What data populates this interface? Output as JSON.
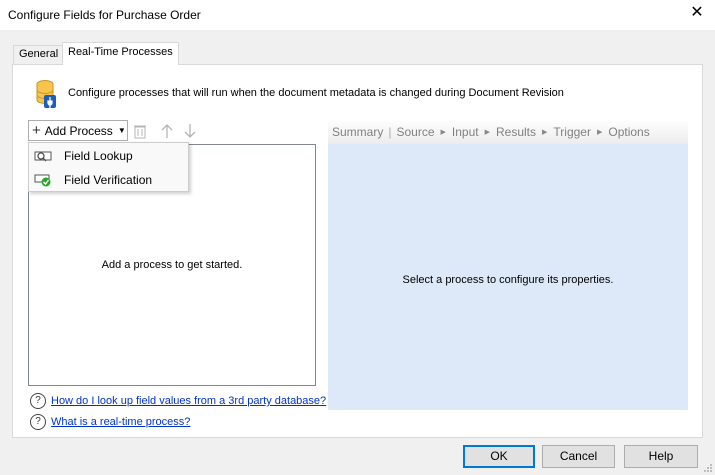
{
  "window": {
    "title": "Configure Fields for Purchase Order"
  },
  "tabs": [
    {
      "label": "General"
    },
    {
      "label": "Real-Time Processes"
    }
  ],
  "intro_text": "Configure processes that will run when the document metadata is changed during Document Revision",
  "toolbar": {
    "add_label": "Add Process"
  },
  "dropdown": {
    "items": [
      {
        "label": "Field Lookup",
        "icon": "field-lookup-icon"
      },
      {
        "label": "Field Verification",
        "icon": "field-verification-icon"
      }
    ]
  },
  "left_empty": "Add a process to get started.",
  "breadcrumb": {
    "summary": "Summary",
    "source": "Source",
    "input": "Input",
    "results": "Results",
    "trigger": "Trigger",
    "options": "Options"
  },
  "right_empty": "Select a process to configure its properties.",
  "help": {
    "link1": "How do I look up field values from a 3rd party database?",
    "link2": "What is a real-time process?"
  },
  "buttons": {
    "ok": "OK",
    "cancel": "Cancel",
    "help": "Help"
  }
}
